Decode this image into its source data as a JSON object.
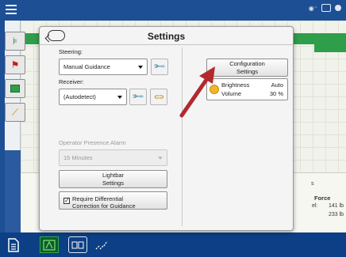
{
  "dialog": {
    "title": "Settings",
    "steering": {
      "label": "Steering:",
      "value": "Manual Guidance"
    },
    "receiver": {
      "label": "Receiver:",
      "value": "(Autodetect)"
    },
    "alarm": {
      "label": "Operator Presence Alarm",
      "value": "15 Minutes"
    },
    "lightbar_button": {
      "line1": "Lightbar",
      "line2": "Settings"
    },
    "differential": {
      "checked": true,
      "line1": "Require Differential",
      "line2": "Correction for Guidance"
    },
    "config_button": {
      "line1": "Configuration",
      "line2": "Settings"
    },
    "brightness": {
      "label": "Brightness",
      "value": "Auto"
    },
    "volume": {
      "label": "Volume",
      "value": "30 %"
    }
  },
  "background": {
    "force_label": "Force",
    "value1": "141 lb",
    "value2": "233 lb",
    "prefix1": "el:",
    "letter": "s"
  },
  "colors": {
    "top_bar": "#1d4f94",
    "bottom_bar": "#0c3f85",
    "field_green": "#2f9e4a",
    "arrow": "#b3282e"
  }
}
